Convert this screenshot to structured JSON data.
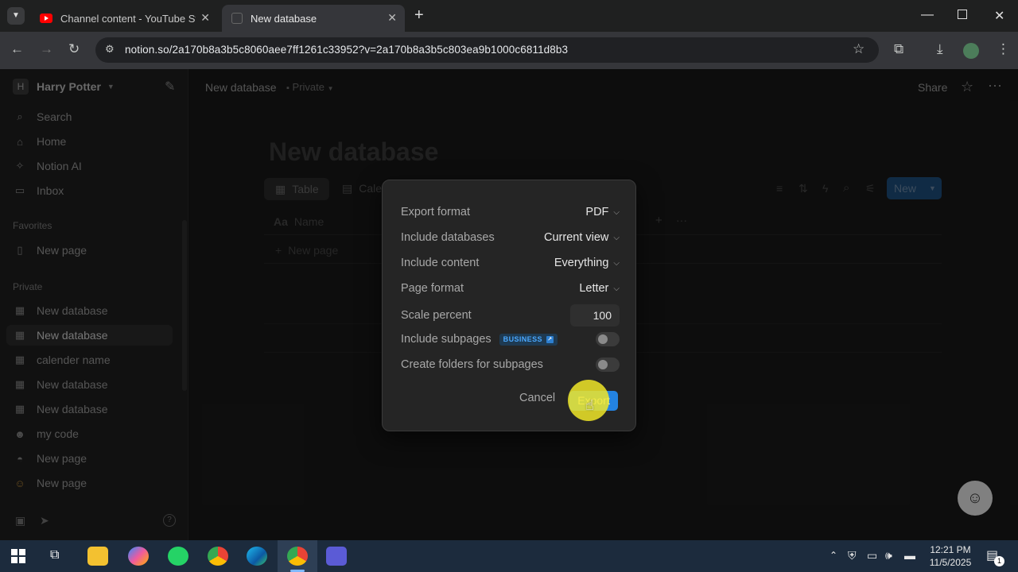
{
  "browser": {
    "tabs": [
      {
        "title": "Channel content - YouTube Stu",
        "active": false
      },
      {
        "title": "New database",
        "active": true
      }
    ],
    "url": "notion.so/2a170b8a3b5c8060aee7ff1261c33952?v=2a170b8a3b5c803ea9b1000c6811d8b3"
  },
  "sidebar": {
    "workspace_initial": "H",
    "workspace_name": "Harry Potter",
    "nav": [
      "Search",
      "Home",
      "Notion AI",
      "Inbox"
    ],
    "favorites_label": "Favorites",
    "favorites": [
      "New page"
    ],
    "private_label": "Private",
    "private": [
      "New database",
      "New database",
      "calender name",
      "New database",
      "New database",
      "my code",
      "New page",
      "New page"
    ]
  },
  "main": {
    "breadcrumb": "New database",
    "privacy": "Private",
    "share_label": "Share",
    "page_title": "New database",
    "views": [
      "Table",
      "Cale"
    ],
    "new_button": "New",
    "column_name": "Name",
    "new_row": "New page"
  },
  "dialog": {
    "rows": [
      {
        "label": "Export format",
        "value": "PDF"
      },
      {
        "label": "Include databases",
        "value": "Current view"
      },
      {
        "label": "Include content",
        "value": "Everything"
      },
      {
        "label": "Page format",
        "value": "Letter"
      }
    ],
    "scale_label": "Scale percent",
    "scale_value": "100",
    "subpages_label": "Include subpages",
    "business_badge": "BUSINESS",
    "subpages_on": false,
    "folders_label": "Create folders for subpages",
    "folders_on": false,
    "cancel_label": "Cancel",
    "export_label": "Export"
  },
  "taskbar": {
    "time": "12:21 PM",
    "date": "11/5/2025",
    "notification_count": "1"
  },
  "colors": {
    "accent": "#2383e2",
    "youtube": "#ff0000",
    "business_badge": "#4aa8ff"
  }
}
